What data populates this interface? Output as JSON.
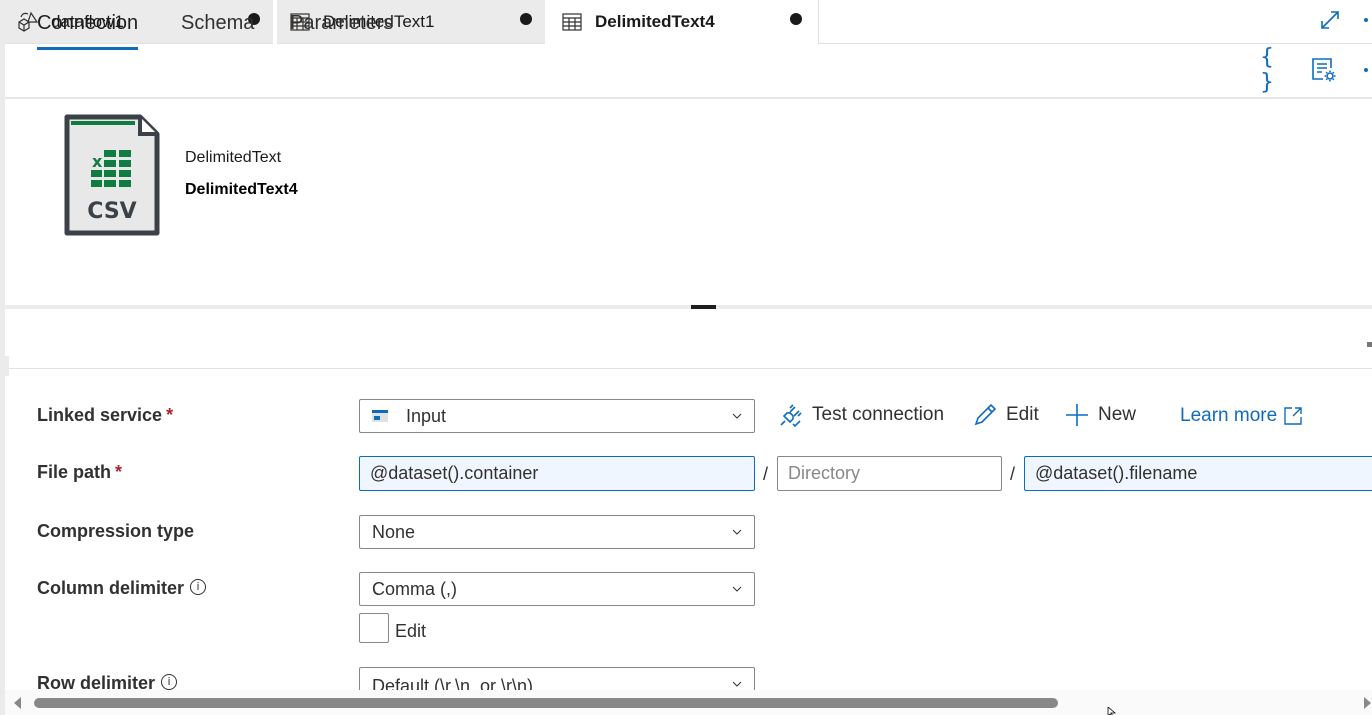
{
  "tabs": [
    {
      "label": "dataflow1",
      "icon": "dataflow-icon",
      "unsaved": true,
      "active": false
    },
    {
      "label": "DelimitedText1",
      "icon": "table-icon",
      "unsaved": true,
      "active": false
    },
    {
      "label": "DelimitedText4",
      "icon": "table-icon",
      "unsaved": true,
      "active": true
    }
  ],
  "toolbar": {
    "code_icon": "{ }",
    "properties_icon": "properties-icon"
  },
  "dataset": {
    "icon_label": "CSV",
    "type": "DelimitedText",
    "name": "DelimitedText4"
  },
  "subtabs": [
    {
      "label": "Connection",
      "active": true
    },
    {
      "label": "Schema",
      "active": false
    },
    {
      "label": "Parameters",
      "active": false
    }
  ],
  "form": {
    "linked_service": {
      "label": "Linked service",
      "required": "*",
      "value": "Input",
      "actions": {
        "test_connection": "Test connection",
        "edit": "Edit",
        "new": "New",
        "learn_more": "Learn more"
      }
    },
    "file_path": {
      "label": "File path",
      "required": "*",
      "container": "@dataset().container",
      "directory_placeholder": "Directory",
      "filename": "@dataset().filename",
      "separator": "/"
    },
    "compression_type": {
      "label": "Compression type",
      "value": "None"
    },
    "column_delimiter": {
      "label": "Column delimiter",
      "info": "i",
      "value": "Comma (,)",
      "edit_label": "Edit",
      "edit_checked": false
    },
    "row_delimiter": {
      "label": "Row delimiter",
      "info": "i",
      "value": "Default (\\r,\\n, or \\r\\n)"
    }
  },
  "colors": {
    "accent": "#0f6cbd",
    "required": "#a4262c",
    "excel_green": "#107c41"
  }
}
